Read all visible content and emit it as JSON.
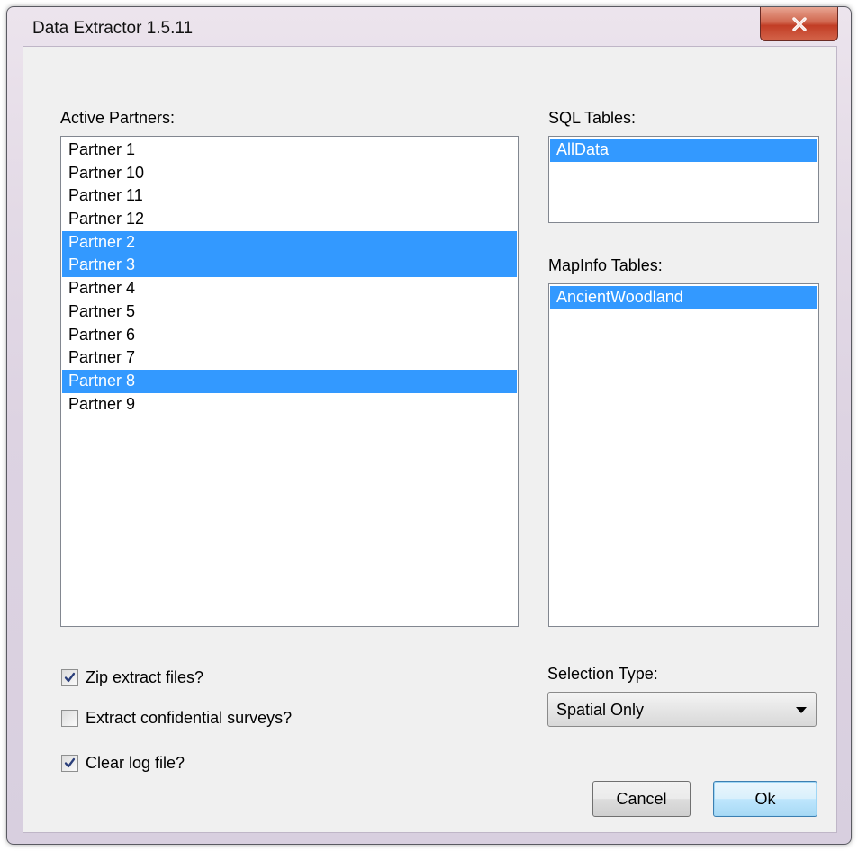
{
  "window": {
    "title": "Data Extractor 1.5.11"
  },
  "partners": {
    "label": "Active Partners:",
    "items": [
      {
        "label": "Partner 1",
        "selected": false
      },
      {
        "label": "Partner 10",
        "selected": false
      },
      {
        "label": "Partner 11",
        "selected": false
      },
      {
        "label": "Partner 12",
        "selected": false
      },
      {
        "label": "Partner 2",
        "selected": true
      },
      {
        "label": "Partner 3",
        "selected": true
      },
      {
        "label": "Partner 4",
        "selected": false
      },
      {
        "label": "Partner 5",
        "selected": false
      },
      {
        "label": "Partner 6",
        "selected": false
      },
      {
        "label": "Partner 7",
        "selected": false
      },
      {
        "label": "Partner 8",
        "selected": true
      },
      {
        "label": "Partner 9",
        "selected": false
      }
    ]
  },
  "sql_tables": {
    "label": "SQL Tables:",
    "items": [
      {
        "label": "AllData",
        "selected": true
      }
    ]
  },
  "mapinfo_tables": {
    "label": "MapInfo Tables:",
    "items": [
      {
        "label": "AncientWoodland",
        "selected": true
      }
    ]
  },
  "options": {
    "zip": {
      "label": "Zip extract files?",
      "checked": true
    },
    "confidential": {
      "label": "Extract confidential surveys?",
      "checked": false
    },
    "clear_log": {
      "label": "Clear log file?",
      "checked": true
    }
  },
  "selection_type": {
    "label": "Selection Type:",
    "value": "Spatial Only"
  },
  "buttons": {
    "cancel": "Cancel",
    "ok": "Ok"
  },
  "colors": {
    "selection": "#3399ff",
    "close_button": "#c23d25"
  }
}
